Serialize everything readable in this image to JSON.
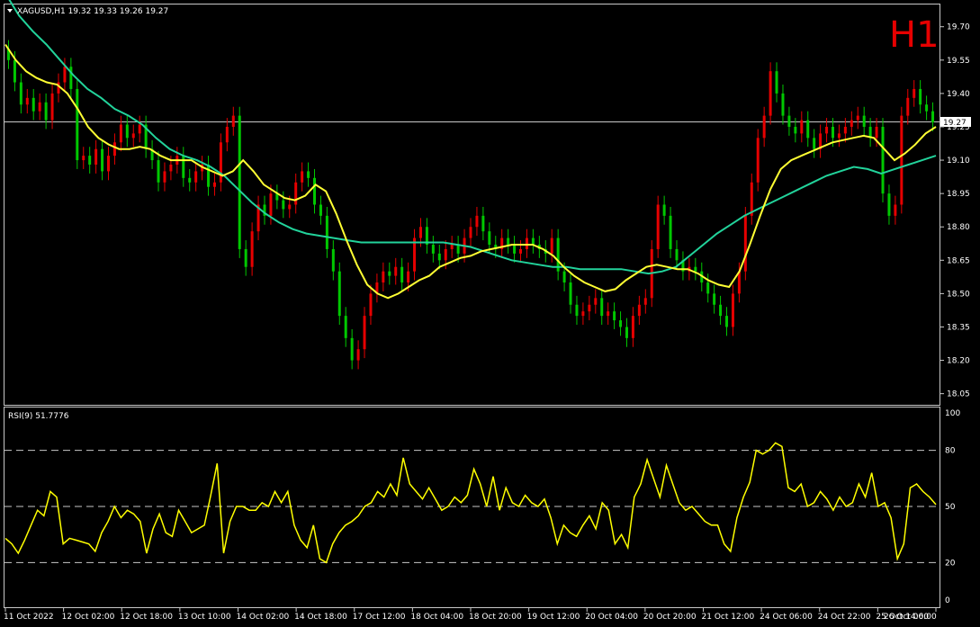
{
  "chart_data": [
    {
      "type": "candlestick",
      "symbol_header": "XAGUSD,H1  19.32 19.33 19.26 19.27",
      "timeframe_label": "H1",
      "current_price_label": "19.27",
      "current_price": 19.27,
      "ylim": [
        18.0,
        19.8
      ],
      "y_ticks": [
        "19.70",
        "19.55",
        "19.40",
        "19.25",
        "19.10",
        "18.95",
        "18.80",
        "18.65",
        "18.50",
        "18.35",
        "18.20",
        "18.05"
      ],
      "x_tick_labels": [
        "11 Oct 2022",
        "12 Oct 02:00",
        "12 Oct 18:00",
        "13 Oct 10:00",
        "14 Oct 02:00",
        "14 Oct 18:00",
        "17 Oct 12:00",
        "18 Oct 04:00",
        "18 Oct 20:00",
        "19 Oct 12:00",
        "20 Oct 04:00",
        "20 Oct 20:00",
        "21 Oct 12:00",
        "24 Oct 06:00",
        "24 Oct 22:00",
        "25 Oct 14:00",
        "26 Oct 06:00"
      ],
      "close": [
        19.55,
        19.45,
        19.35,
        19.38,
        19.32,
        19.36,
        19.28,
        19.4,
        19.45,
        19.52,
        19.42,
        19.1,
        19.12,
        19.08,
        19.15,
        19.05,
        19.12,
        19.18,
        19.26,
        19.2,
        19.22,
        19.26,
        19.15,
        19.1,
        19.0,
        19.05,
        19.08,
        19.12,
        19.02,
        19.0,
        19.05,
        19.08,
        18.98,
        19.0,
        19.18,
        19.25,
        19.3,
        18.7,
        18.62,
        18.78,
        18.9,
        18.85,
        18.95,
        18.92,
        18.88,
        18.9,
        19.0,
        19.05,
        19.02,
        18.9,
        18.85,
        18.7,
        18.6,
        18.4,
        18.3,
        18.2,
        18.25,
        18.4,
        18.5,
        18.55,
        18.6,
        18.58,
        18.62,
        18.55,
        18.6,
        18.75,
        18.8,
        18.72,
        18.68,
        18.65,
        18.7,
        18.72,
        18.68,
        18.75,
        18.8,
        18.85,
        18.78,
        18.72,
        18.7,
        18.75,
        18.72,
        18.68,
        18.7,
        18.75,
        18.72,
        18.7,
        18.68,
        18.75,
        18.6,
        18.55,
        18.45,
        18.4,
        18.42,
        18.45,
        18.48,
        18.4,
        18.42,
        18.38,
        18.35,
        18.3,
        18.4,
        18.45,
        18.48,
        18.7,
        18.9,
        18.85,
        18.7,
        18.65,
        18.6,
        18.62,
        18.6,
        18.55,
        18.5,
        18.45,
        18.4,
        18.35,
        18.5,
        18.6,
        18.85,
        19.0,
        19.2,
        19.3,
        19.5,
        19.4,
        19.3,
        19.25,
        19.22,
        19.28,
        19.2,
        19.15,
        19.22,
        19.25,
        19.2,
        19.22,
        19.25,
        19.28,
        19.3,
        19.25,
        19.2,
        19.25,
        18.95,
        18.85,
        18.9,
        19.3,
        19.38,
        19.42,
        19.35,
        19.32,
        19.27
      ],
      "ma_fast": [
        19.62,
        19.55,
        19.5,
        19.47,
        19.45,
        19.44,
        19.4,
        19.33,
        19.25,
        19.2,
        19.17,
        19.15,
        19.15,
        19.16,
        19.15,
        19.12,
        19.1,
        19.1,
        19.1,
        19.07,
        19.05,
        19.03,
        19.05,
        19.1,
        19.05,
        18.99,
        18.96,
        18.93,
        18.92,
        18.94,
        18.99,
        18.96,
        18.86,
        18.74,
        18.63,
        18.54,
        18.5,
        18.48,
        18.5,
        18.53,
        18.56,
        18.58,
        18.62,
        18.64,
        18.66,
        18.67,
        18.69,
        18.7,
        18.71,
        18.72,
        18.72,
        18.72,
        18.7,
        18.67,
        18.62,
        18.58,
        18.55,
        18.53,
        18.51,
        18.52,
        18.56,
        18.59,
        18.62,
        18.63,
        18.62,
        18.61,
        18.61,
        18.59,
        18.56,
        18.54,
        18.53,
        18.6,
        18.72,
        18.85,
        18.97,
        19.06,
        19.1,
        19.12,
        19.14,
        19.16,
        19.18,
        19.19,
        19.2,
        19.21,
        19.2,
        19.15,
        19.1,
        19.13,
        19.17,
        19.22,
        19.25
      ],
      "ma_slow": [
        19.85,
        19.75,
        19.68,
        19.62,
        19.55,
        19.48,
        19.42,
        19.38,
        19.33,
        19.3,
        19.26,
        19.2,
        19.15,
        19.12,
        19.1,
        19.07,
        19.03,
        18.97,
        18.91,
        18.86,
        18.82,
        18.79,
        18.77,
        18.76,
        18.75,
        18.74,
        18.73,
        18.73,
        18.73,
        18.73,
        18.73,
        18.73,
        18.73,
        18.72,
        18.71,
        18.69,
        18.67,
        18.65,
        18.64,
        18.63,
        18.62,
        18.62,
        18.61,
        18.61,
        18.61,
        18.61,
        18.6,
        18.59,
        18.6,
        18.62,
        18.67,
        18.72,
        18.77,
        18.81,
        18.85,
        18.88,
        18.91,
        18.94,
        18.97,
        19.0,
        19.03,
        19.05,
        19.07,
        19.06,
        19.04,
        19.06,
        19.08,
        19.1,
        19.12
      ]
    },
    {
      "type": "line",
      "indicator_header": "RSI(9) 51.7776",
      "ylim": [
        0,
        100
      ],
      "y_ticks": [
        "100",
        "80",
        "50",
        "20",
        "0"
      ],
      "levels": [
        80,
        50,
        20
      ],
      "values": [
        33,
        30,
        25,
        32,
        40,
        48,
        45,
        58,
        55,
        30,
        33,
        32,
        31,
        30,
        26,
        36,
        42,
        50,
        44,
        48,
        46,
        42,
        25,
        38,
        46,
        36,
        34,
        48,
        42,
        36,
        38,
        40,
        56,
        73,
        25,
        42,
        50,
        50,
        48,
        48,
        52,
        50,
        58,
        52,
        58,
        40,
        32,
        28,
        40,
        22,
        20,
        30,
        36,
        40,
        42,
        45,
        50,
        52,
        58,
        55,
        62,
        56,
        76,
        62,
        58,
        54,
        60,
        54,
        48,
        50,
        55,
        52,
        56,
        70,
        62,
        50,
        66,
        48,
        60,
        52,
        50,
        56,
        52,
        50,
        54,
        44,
        30,
        40,
        36,
        34,
        40,
        45,
        38,
        52,
        48,
        30,
        35,
        28,
        55,
        62,
        75,
        65,
        55,
        72,
        62,
        52,
        48,
        50,
        46,
        42,
        40,
        40,
        30,
        26,
        44,
        55,
        63,
        80,
        78,
        80,
        84,
        82,
        60,
        58,
        62,
        50,
        52,
        58,
        54,
        48,
        55,
        50,
        52,
        62,
        55,
        68,
        50,
        52,
        44,
        22,
        30,
        60,
        62,
        58,
        55,
        51
      ]
    }
  ],
  "colors": {
    "background": "#000000",
    "bull_candle": "#e60000",
    "bear_candle": "#00c800",
    "ma_fast": "#ffff33",
    "ma_slow": "#22d39b",
    "rsi": "#ffff00",
    "frame": "#c8c8c8",
    "timeframe_label": "#e60000"
  }
}
